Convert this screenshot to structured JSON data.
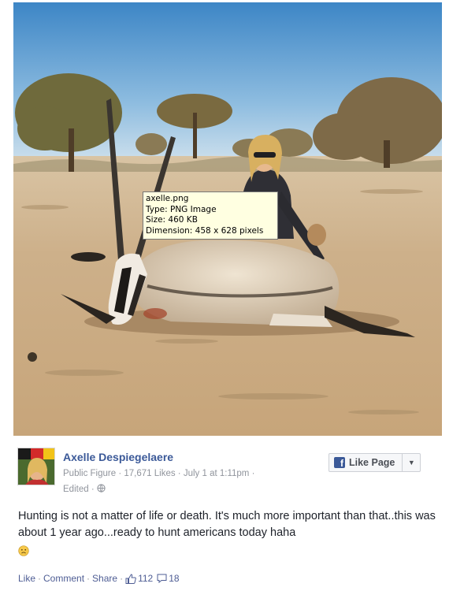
{
  "file_tooltip": {
    "name": "axelle.png",
    "type": "Type: PNG Image",
    "size": "Size: 460 KB",
    "dimension": "Dimension: 458 x 628 pixels"
  },
  "post": {
    "author": "Axelle Despiegelaere",
    "category": "Public Figure",
    "likes": "17,671 Likes",
    "date": "July 1 at 1:11pm",
    "edited": "Edited",
    "separator": "·",
    "message": "Hunting is not a matter of life or death. It's much more important than that..this was about 1 year ago...ready to hunt americans today haha",
    "like_page_label": "Like Page",
    "actions": {
      "like": "Like",
      "comment": "Comment",
      "share": "Share",
      "likes_count": "112",
      "comments_count": "18"
    }
  },
  "icons": {
    "facebook": "facebook-f-icon",
    "globe": "globe-icon",
    "dropdown": "chevron-down-icon",
    "thumbs_up": "thumbs-up-icon",
    "comment": "comment-icon",
    "emoji": "sad-face-emoji-icon"
  },
  "colors": {
    "link": "#3b5998",
    "meta": "#90949c",
    "tooltip_bg": "#ffffe1"
  }
}
